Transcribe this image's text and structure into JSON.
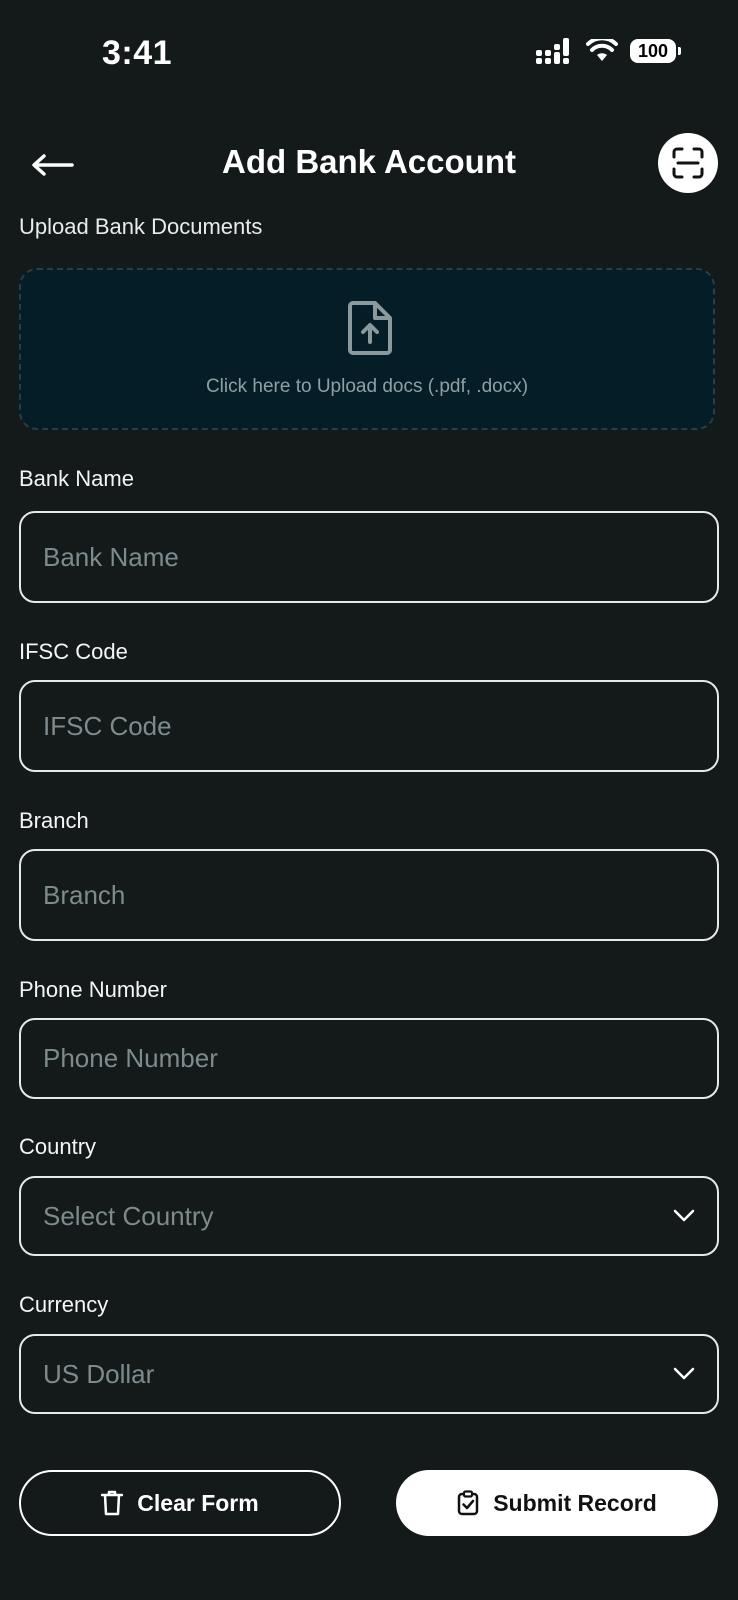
{
  "status_bar": {
    "time": "3:41",
    "battery": "100",
    "icons": [
      "signal-icon",
      "wifi-icon",
      "battery-icon"
    ]
  },
  "header": {
    "title": "Add Bank Account",
    "back_icon": "arrow-left-icon",
    "scan_icon": "scan-icon"
  },
  "upload": {
    "label": "Upload Bank Documents",
    "icon": "file-upload-icon",
    "text": "Click here to Upload docs (.pdf, .docx)"
  },
  "fields": {
    "bank_name": {
      "label": "Bank Name",
      "placeholder": "Bank Name",
      "value": ""
    },
    "ifsc": {
      "label": "IFSC Code",
      "placeholder": "IFSC Code",
      "value": ""
    },
    "branch": {
      "label": "Branch",
      "placeholder": "Branch",
      "value": ""
    },
    "phone": {
      "label": "Phone Number",
      "placeholder": "Phone Number",
      "value": ""
    },
    "country": {
      "label": "Country",
      "value": "Select Country",
      "icon": "chevron-down-icon"
    },
    "currency": {
      "label": "Currency",
      "value": "US Dollar",
      "icon": "chevron-down-icon"
    }
  },
  "actions": {
    "clear": {
      "label": "Clear Form",
      "icon": "trash-icon"
    },
    "submit": {
      "label": "Submit Record",
      "icon": "clipboard-check-icon"
    }
  },
  "colors": {
    "background": "#141919",
    "upload_bg": "#051d26",
    "placeholder": "#7d8b8e",
    "accent": "#ffffff"
  }
}
